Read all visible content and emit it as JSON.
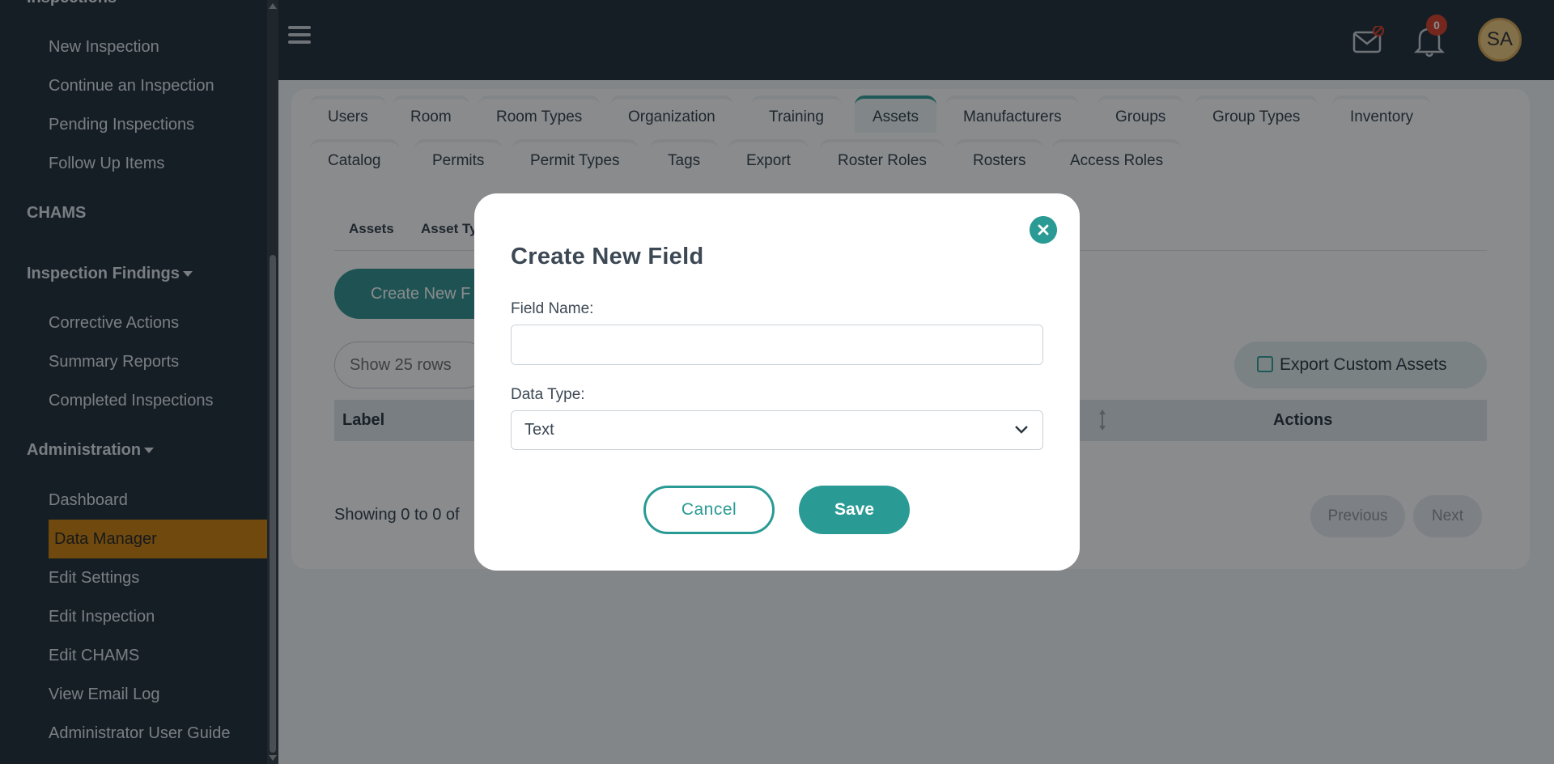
{
  "sidebar": {
    "partial_heading": "Inspections",
    "inspection_items": [
      "New Inspection",
      "Continue an Inspection",
      "Pending Inspections",
      "Follow Up Items"
    ],
    "chams_label": "CHAMS",
    "findings_label": "Inspection Findings",
    "findings_items": [
      "Corrective Actions",
      "Summary Reports",
      "Completed Inspections"
    ],
    "admin_label": "Administration",
    "admin_items": [
      "Dashboard",
      "Data Manager",
      "Edit Settings",
      "Edit Inspection",
      "Edit CHAMS",
      "View Email Log",
      "Administrator User Guide"
    ]
  },
  "header": {
    "notification_count": "0",
    "avatar_initials": "SA"
  },
  "tabs_row1": [
    "Users",
    "Room",
    "Room Types",
    "Organization",
    "Training",
    "Assets",
    "Manufacturers",
    "Groups",
    "Group Types",
    "Inventory"
  ],
  "tabs_row2": [
    "Catalog",
    "Permits",
    "Permit Types",
    "Tags",
    "Export",
    "Roster Roles",
    "Rosters",
    "Access Roles"
  ],
  "active_tab": "Assets",
  "subtabs": [
    "Assets",
    "Asset Ty"
  ],
  "create_button_partial": "Create New F",
  "rows_select": "Show 25 rows",
  "export_button": "Export Custom Assets",
  "table": {
    "col_label": "Label",
    "col_actions": "Actions"
  },
  "showing_text": "Showing 0 to 0 of",
  "pagination": {
    "previous": "Previous",
    "next": "Next"
  },
  "modal": {
    "title": "Create New Field",
    "field_name_label": "Field Name:",
    "field_name_value": "",
    "data_type_label": "Data Type:",
    "data_type_value": "Text",
    "cancel": "Cancel",
    "save": "Save"
  },
  "colors": {
    "accent": "#2a9a94",
    "sidebar": "#19242f",
    "active_item": "#cc7a00"
  }
}
